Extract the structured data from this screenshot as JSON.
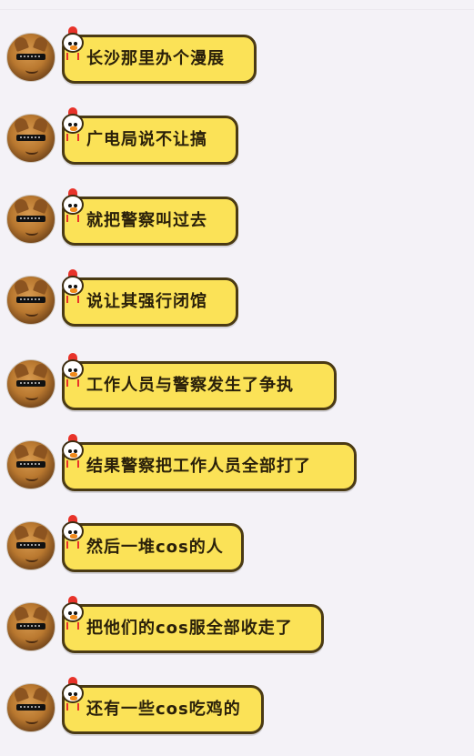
{
  "messages": [
    {
      "text": "长沙那里办个漫展"
    },
    {
      "text": "广电局说不让搞"
    },
    {
      "text": "就把警察叫过去"
    },
    {
      "text": "说让其强行闭馆"
    },
    {
      "text": "工作人员与警察发生了争执"
    },
    {
      "text": "结果警察把工作人员全部打了"
    },
    {
      "text": "然后一堆cos的人"
    },
    {
      "text": "把他们的cos服全部收走了"
    },
    {
      "text": "还有一些cos吃鸡的"
    }
  ],
  "colors": {
    "background": "#f4f2f7",
    "bubble": "#fbe257",
    "bubble_border": "#4a3a14",
    "text": "#2a200a"
  },
  "icons": {
    "avatar": "dog-with-sunglasses-avatar",
    "bubble_decoration": "chick-icon"
  }
}
